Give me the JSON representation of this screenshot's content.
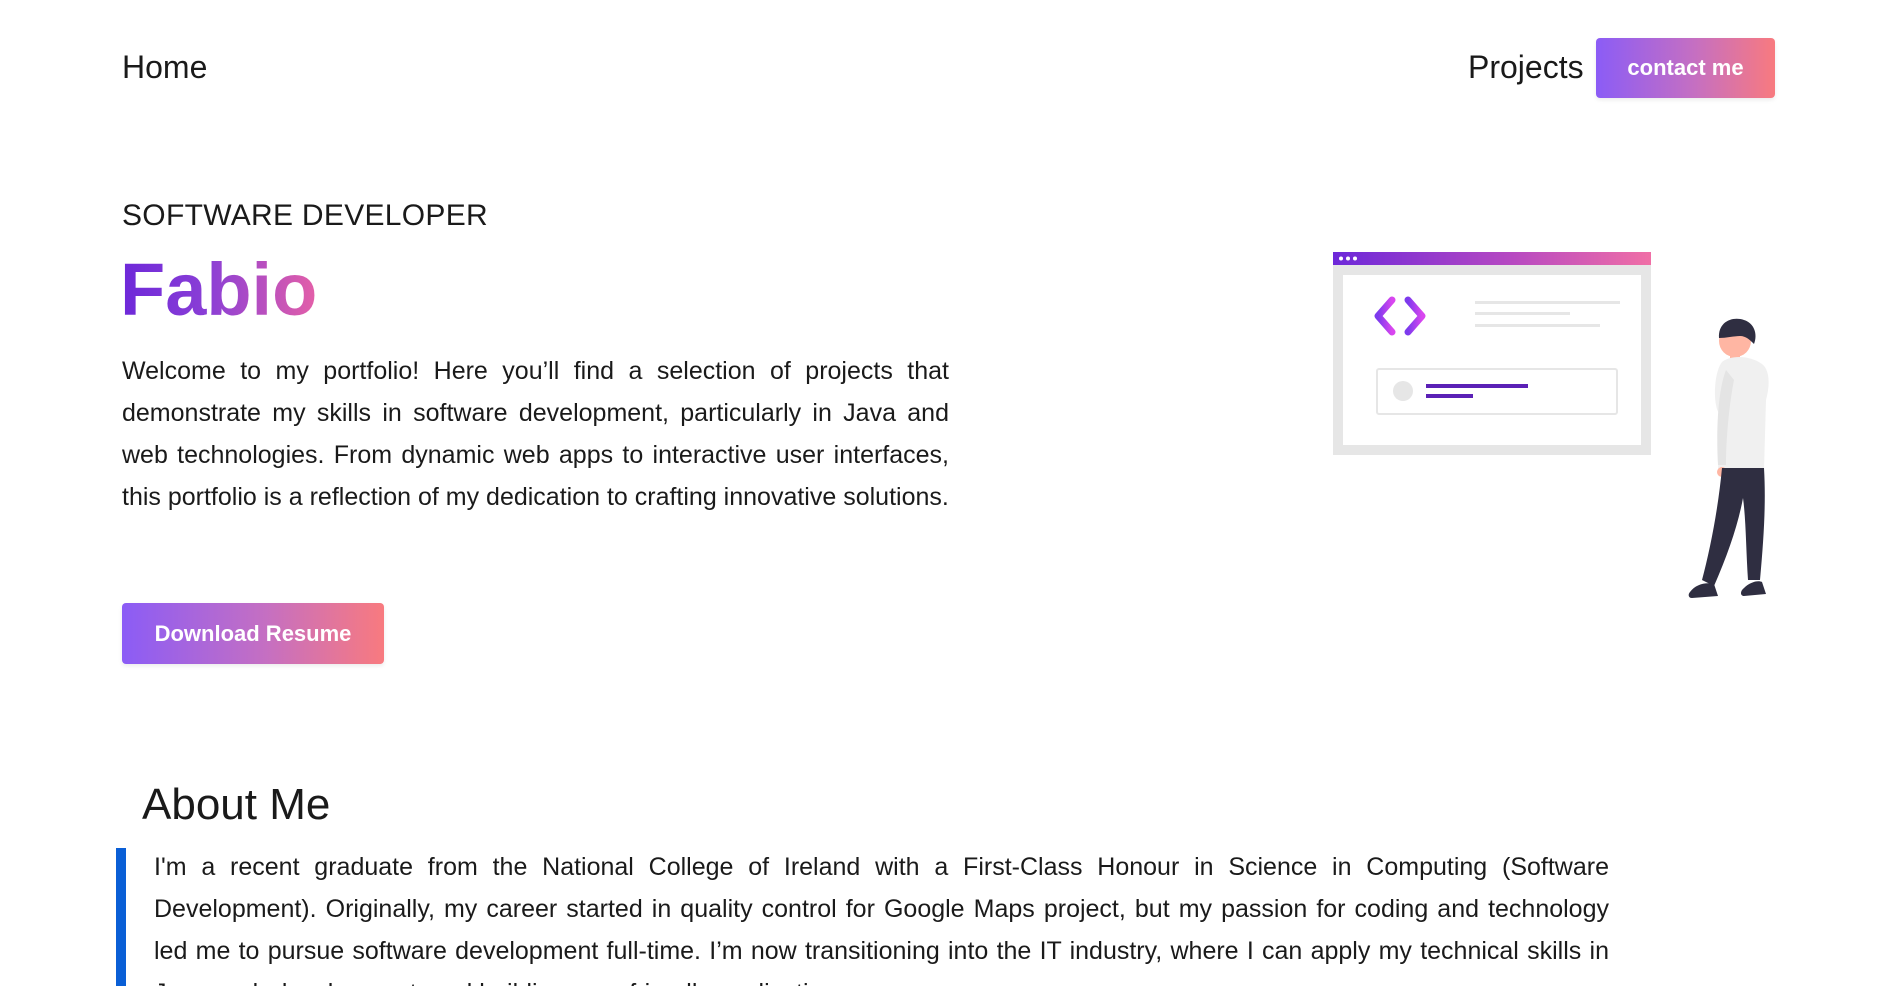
{
  "nav": {
    "home_label": "Home",
    "projects_label": "Projects",
    "contact_label": "contact me"
  },
  "hero": {
    "subtitle": "SOFTWARE DEVELOPER",
    "name": "Fabio",
    "description": "Welcome to my portfolio! Here you’ll find a selection of projects that demonstrate my skills in software development, particularly in Java and web technologies. From dynamic web apps to interactive user interfaces, this portfolio is a reflection of my dedication to crafting innovative solutions.",
    "download_label": "Download Resume",
    "illustration_icon": "developer-illustration"
  },
  "about": {
    "title": "About Me",
    "text": "I'm a recent graduate from the National College of Ireland with a First-Class Honour in Science in Computing (Software Development). Originally, my career started in quality control for Google Maps project, but my passion for coding and technology led me to pursue software development full-time. I’m now transitioning into the IT industry, where I can apply my technical skills in Java, web development, and building user-friendly applications."
  },
  "colors": {
    "gradient_start": "#8b5cf6",
    "gradient_end": "#f87a7f",
    "name_gradient_start": "#6d28d9",
    "name_gradient_end": "#e45fa8",
    "about_accent": "#0a5fd6"
  }
}
